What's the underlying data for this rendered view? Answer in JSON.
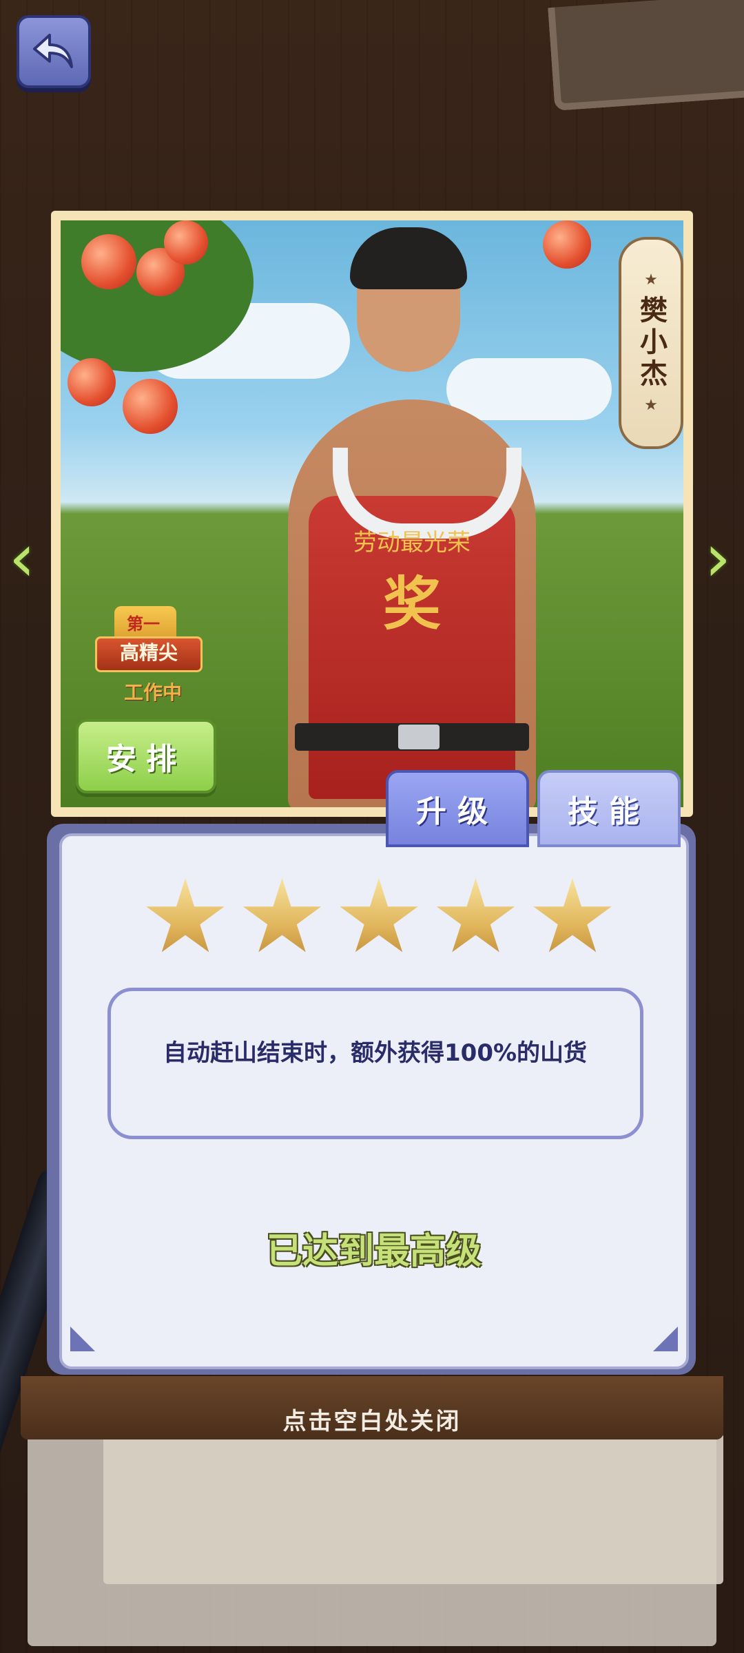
{
  "top": {
    "back_icon": "back-arrow-icon"
  },
  "nav": {
    "prev_arrow": "‹",
    "next_arrow": "›"
  },
  "character": {
    "name": "樊小杰",
    "shirt_line1": "劳动最光荣",
    "shirt_line2": "奖",
    "badge": {
      "rank": "第一",
      "title": "高精尖"
    },
    "status": "工作中",
    "arrange_button": "安排"
  },
  "tabs": [
    {
      "label": "升级",
      "active": true
    },
    {
      "label": "技能",
      "active": false
    }
  ],
  "level": {
    "stars": 5,
    "max_stars": 5
  },
  "skill_description": "自动赶山结束时，额外获得100%的山货",
  "max_level_text": "已达到最高级",
  "close_hint": "点击空白处关闭",
  "colors": {
    "star_gold": "#e0b45a",
    "panel_purple": "#6a6fa5",
    "button_green": "#8ecf4a"
  }
}
